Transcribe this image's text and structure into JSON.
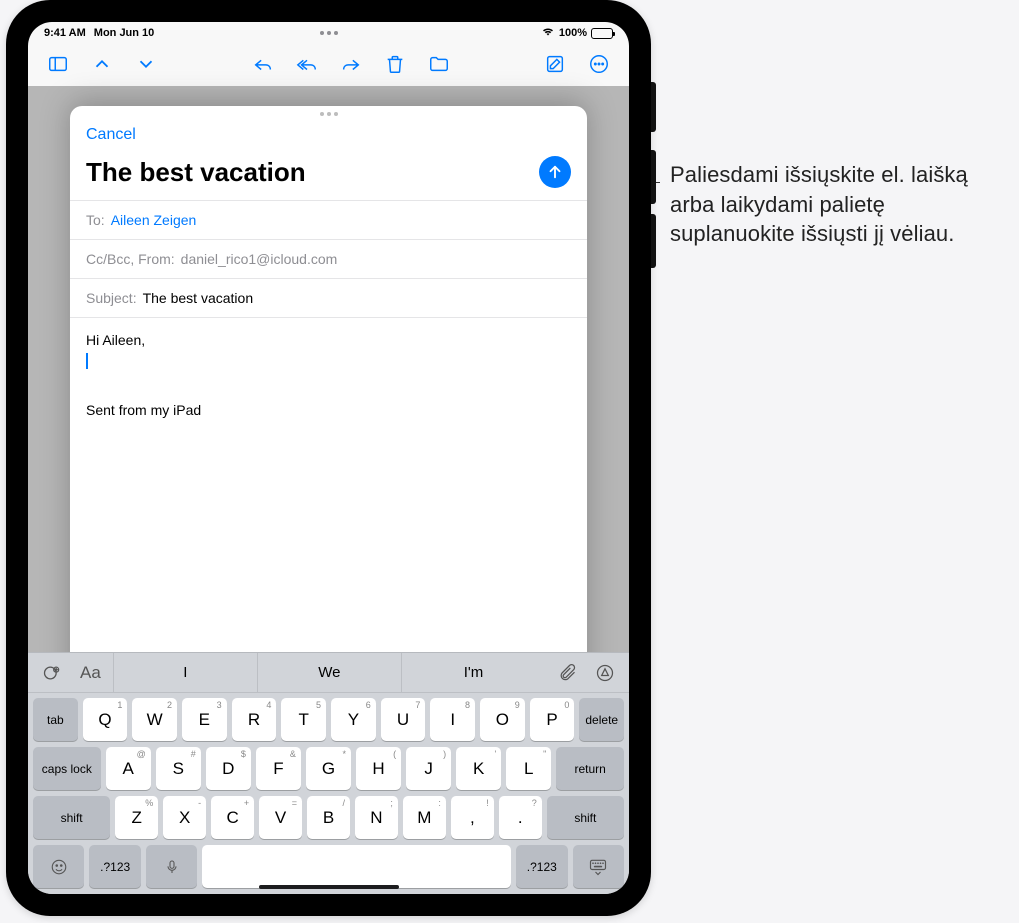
{
  "status": {
    "time": "9:41 AM",
    "date": "Mon Jun 10",
    "battery_pct": "100%"
  },
  "callout": {
    "text": "Paliesdami išsiųskite el. laišką arba laikydami palietę suplanuokite išsiųsti jį vėliau."
  },
  "compose": {
    "cancel": "Cancel",
    "title": "The best vacation",
    "to_label": "To:",
    "to_value": "Aileen Zeigen",
    "cc_label": "Cc/Bcc, From:",
    "cc_value": "daniel_rico1@icloud.com",
    "subject_label": "Subject:",
    "subject_value": "The best vacation",
    "body_greeting": "Hi Aileen,",
    "signature": "Sent from my iPad"
  },
  "keyboard": {
    "format_label": "Aa",
    "predictions": [
      "I",
      "We",
      "I'm"
    ],
    "row1": [
      {
        "main": "Q",
        "sub": "1"
      },
      {
        "main": "W",
        "sub": "2"
      },
      {
        "main": "E",
        "sub": "3"
      },
      {
        "main": "R",
        "sub": "4"
      },
      {
        "main": "T",
        "sub": "5"
      },
      {
        "main": "Y",
        "sub": "6"
      },
      {
        "main": "U",
        "sub": "7"
      },
      {
        "main": "I",
        "sub": "8"
      },
      {
        "main": "O",
        "sub": "9"
      },
      {
        "main": "P",
        "sub": "0"
      }
    ],
    "row2": [
      {
        "main": "A",
        "sub": "@"
      },
      {
        "main": "S",
        "sub": "#"
      },
      {
        "main": "D",
        "sub": "$"
      },
      {
        "main": "F",
        "sub": "&"
      },
      {
        "main": "G",
        "sub": "*"
      },
      {
        "main": "H",
        "sub": "("
      },
      {
        "main": "J",
        "sub": ")"
      },
      {
        "main": "K",
        "sub": "'"
      },
      {
        "main": "L",
        "sub": "\""
      }
    ],
    "row3": [
      {
        "main": "Z",
        "sub": "%"
      },
      {
        "main": "X",
        "sub": "-"
      },
      {
        "main": "C",
        "sub": "+"
      },
      {
        "main": "V",
        "sub": "="
      },
      {
        "main": "B",
        "sub": "/"
      },
      {
        "main": "N",
        "sub": ";"
      },
      {
        "main": "M",
        "sub": ":"
      },
      {
        "main": ",",
        "sub": "!"
      },
      {
        "main": ".",
        "sub": "?"
      }
    ],
    "tab": "tab",
    "delete": "delete",
    "caps": "caps lock",
    "return": "return",
    "shift": "shift",
    "numkey": ".?123"
  }
}
